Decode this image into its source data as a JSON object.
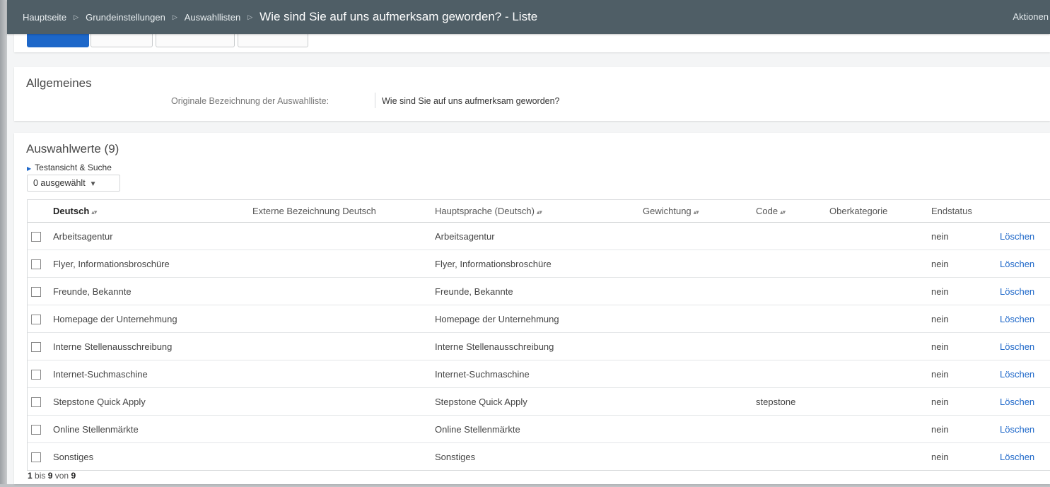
{
  "breadcrumb": {
    "items": [
      "Hauptseite",
      "Grundeinstellungen",
      "Auswahllisten"
    ],
    "title": "Wie sind Sie auf uns aufmerksam geworden? - Liste",
    "actions_label": "Aktionen"
  },
  "allgemeines": {
    "title": "Allgemeines",
    "label": "Originale Bezeichnung der Auswahlliste:",
    "value": "Wie sind Sie auf uns aufmerksam geworden?"
  },
  "auswahlwerte": {
    "title": "Auswahlwerte (9)",
    "test_link": "Testansicht & Suche",
    "selected_label": "0 ausgewählt"
  },
  "table": {
    "columns": [
      "Deutsch",
      "Externe Bezeichnung Deutsch",
      "Hauptsprache (Deutsch)",
      "Gewichtung",
      "Code",
      "Oberkategorie",
      "Endstatus"
    ],
    "delete_label": "Löschen",
    "rows": [
      {
        "deutsch": "Arbeitsagentur",
        "extern": "",
        "haupt": "Arbeitsagentur",
        "gew": "",
        "code": "",
        "ober": "",
        "end": "nein"
      },
      {
        "deutsch": "Flyer, Informationsbroschüre",
        "extern": "",
        "haupt": "Flyer, Informationsbroschüre",
        "gew": "",
        "code": "",
        "ober": "",
        "end": "nein"
      },
      {
        "deutsch": "Freunde, Bekannte",
        "extern": "",
        "haupt": "Freunde, Bekannte",
        "gew": "",
        "code": "",
        "ober": "",
        "end": "nein"
      },
      {
        "deutsch": "Homepage der Unternehmung",
        "extern": "",
        "haupt": "Homepage der Unternehmung",
        "gew": "",
        "code": "",
        "ober": "",
        "end": "nein"
      },
      {
        "deutsch": "Interne Stellenausschreibung",
        "extern": "",
        "haupt": "Interne Stellenausschreibung",
        "gew": "",
        "code": "",
        "ober": "",
        "end": "nein"
      },
      {
        "deutsch": "Internet-Suchmaschine",
        "extern": "",
        "haupt": "Internet-Suchmaschine",
        "gew": "",
        "code": "",
        "ober": "",
        "end": "nein"
      },
      {
        "deutsch": "Stepstone Quick Apply",
        "extern": "",
        "haupt": "Stepstone Quick Apply",
        "gew": "",
        "code": "stepstone",
        "ober": "",
        "end": "nein"
      },
      {
        "deutsch": "Online Stellenmärkte",
        "extern": "",
        "haupt": "Online Stellenmärkte",
        "gew": "",
        "code": "",
        "ober": "",
        "end": "nein"
      },
      {
        "deutsch": "Sonstiges",
        "extern": "",
        "haupt": "Sonstiges",
        "gew": "",
        "code": "",
        "ober": "",
        "end": "nein"
      }
    ]
  },
  "pager": {
    "from": "1",
    "to_label": "bis",
    "to": "9",
    "of_label": "von",
    "total": "9"
  },
  "icons": {
    "separator": "breadcrumb-separator-icon",
    "sort": "sort-icon",
    "caret": "caret-down-icon",
    "disclosure": "disclosure-triangle-icon",
    "checkbox": "checkbox-icon"
  },
  "colors": {
    "header": "#4f5e66",
    "link": "#1d67c9",
    "primary": "#1d67c9"
  }
}
